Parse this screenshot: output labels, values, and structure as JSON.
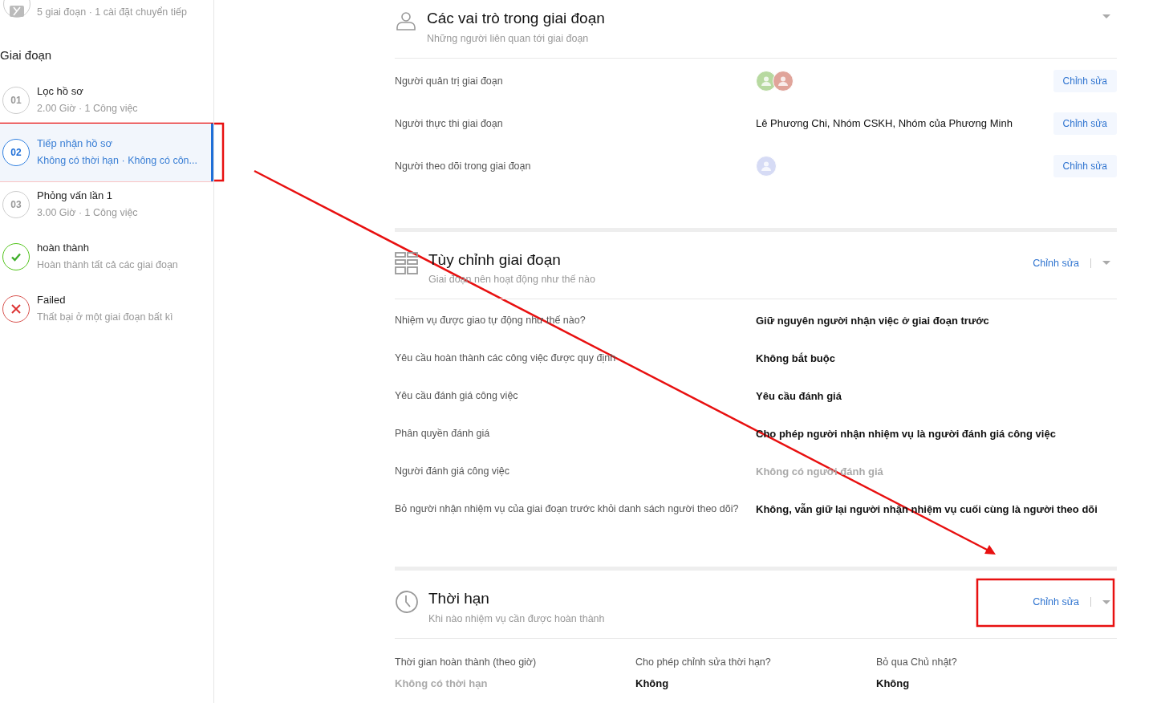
{
  "sidebar": {
    "process": {
      "subtitle": "5 giai đoạn · 1 cài đặt chuyển tiếp"
    },
    "heading": "Giai đoạn",
    "stages": [
      {
        "kind": "step",
        "number": "01",
        "name": "Lọc hồ sơ",
        "meta": "2.00 Giờ · 1 Công việc",
        "selected": false
      },
      {
        "kind": "step",
        "number": "02",
        "name": "Tiếp nhận hồ sơ",
        "meta": "Không có thời hạn · Không có côn...",
        "selected": true
      },
      {
        "kind": "step",
        "number": "03",
        "name": "Phỏng vấn lần 1",
        "meta": "3.00 Giờ · 1 Công việc",
        "selected": false
      },
      {
        "kind": "done",
        "name": "hoàn thành",
        "meta": "Hoàn thành tất cả các giai đoạn",
        "selected": false
      },
      {
        "kind": "failed",
        "name": "Failed",
        "meta": "Thất bại ở một giai đoạn bất kì",
        "selected": false
      }
    ]
  },
  "roles": {
    "title": "Các vai trò trong giai đoạn",
    "subtitle": "Những người liên quan tới giai đoạn",
    "rows": [
      {
        "label": "Người quản trị giai đoạn",
        "kind": "avatars",
        "avatars": [
          {
            "color": "#b7d9a0"
          },
          {
            "color": "#e0a49a"
          }
        ],
        "button": "Chỉnh sửa"
      },
      {
        "label": "Người thực thi giai đoạn",
        "kind": "text",
        "value": "Lê Phương Chi, Nhóm CSKH, Nhóm của Phương Minh",
        "button": "Chỉnh sửa"
      },
      {
        "label": "Người theo dõi trong giai đoạn",
        "kind": "avatars",
        "avatars": [
          {
            "color": "#d6dbf5"
          }
        ],
        "button": "Chỉnh sửa"
      }
    ]
  },
  "customize": {
    "title": "Tùy chỉnh giai đoạn",
    "subtitle": "Giai đoạn nên hoạt động như thế nào",
    "edit": "Chỉnh sửa",
    "rows": [
      {
        "label": "Nhiệm vụ được giao tự động như thế nào?",
        "value": "Giữ nguyên người nhận việc ở giai đoạn trước",
        "muted": false
      },
      {
        "label": "Yêu cầu hoàn thành các công việc được quy định",
        "value": "Không bắt buộc",
        "muted": false
      },
      {
        "label": "Yêu cầu đánh giá công việc",
        "value": "Yêu cầu đánh giá",
        "muted": false
      },
      {
        "label": "Phân quyền đánh giá",
        "value": "Cho phép người nhận nhiệm vụ là người đánh giá công việc",
        "muted": false
      },
      {
        "label": "Người đánh giá công việc",
        "value": "Không có người đánh giá",
        "muted": true
      },
      {
        "label": "Bỏ người nhận nhiệm vụ của giai đoạn trước khỏi danh sách người theo dõi?",
        "value": "Không, vẫn giữ lại người nhận nhiệm vụ cuối cùng là người theo dõi",
        "muted": false
      }
    ]
  },
  "deadline": {
    "title": "Thời hạn",
    "subtitle": "Khi nào nhiệm vụ cần được hoàn thành",
    "edit": "Chỉnh sửa",
    "fields": [
      {
        "label": "Thời gian hoàn thành (theo giờ)",
        "value": "Không có thời hạn",
        "muted": true
      },
      {
        "label": "Cho phép chỉnh sửa thời hạn?",
        "value": "Không",
        "muted": false
      },
      {
        "label": "Bỏ qua Chủ nhật?",
        "value": "Không",
        "muted": false
      }
    ]
  }
}
